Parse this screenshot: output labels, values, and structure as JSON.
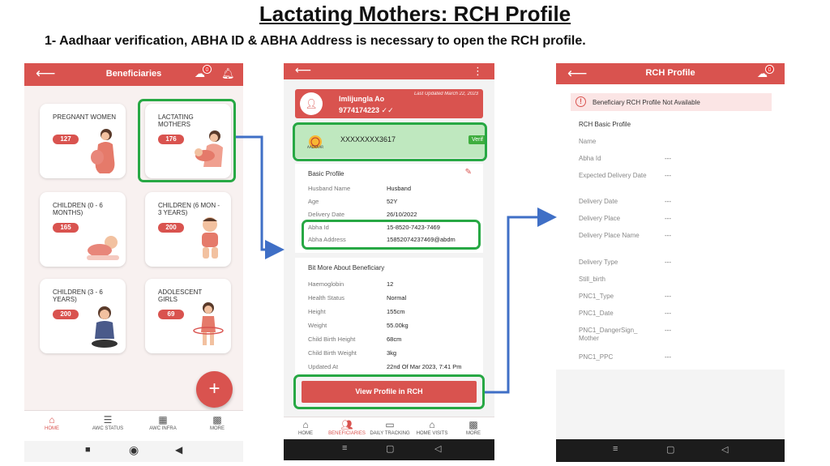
{
  "slide": {
    "title": "Lactating Mothers: RCH Profile",
    "subtitle": "1- Aadhaar verification, ABHA ID & ABHA Address is necessary to open the RCH profile."
  },
  "screen1": {
    "header_title": "Beneficiaries",
    "badge_count": "0",
    "cards": [
      {
        "label": "PREGNANT WOMEN",
        "count": "127"
      },
      {
        "label": "LACTATING MOTHERS",
        "count": "176"
      },
      {
        "label": "CHILDREN (0 - 6 MONTHS)",
        "count": "165"
      },
      {
        "label": "CHILDREN (6 MON - 3 YEARS)",
        "count": "200"
      },
      {
        "label": "CHILDREN (3 - 6 YEARS)",
        "count": "200"
      },
      {
        "label": "ADOLESCENT GIRLS",
        "count": "69"
      }
    ],
    "fab_label": "+",
    "nav": [
      {
        "label": "HOME"
      },
      {
        "label": "AWC STATUS"
      },
      {
        "label": "AWC INFRA"
      },
      {
        "label": "MORE"
      }
    ]
  },
  "screen2": {
    "name": "Imlijungla Ao",
    "phone": "9774174223 ✓✓",
    "last_updated": "Last Updated March 22, 2023",
    "aadhaar_logo_text": "AADHAAR",
    "aadhaar_number": "XXXXXXXX3617",
    "verified_label": "Verif",
    "basic_profile_title": "Basic Profile",
    "basic_rows": [
      {
        "k": "Husband Name",
        "v": "Husband"
      },
      {
        "k": "Age",
        "v": "52Y"
      },
      {
        "k": "Delivery Date",
        "v": "26/10/2022"
      },
      {
        "k": "Abha Id",
        "v": "15-8520-7423-7469"
      },
      {
        "k": "Abha Address",
        "v": "15852074237469@abdm"
      }
    ],
    "more_title": "Bit More About Beneficiary",
    "more_rows": [
      {
        "k": "Haemoglobin",
        "v": "12"
      },
      {
        "k": "Health Status",
        "v": "Normal"
      },
      {
        "k": "Height",
        "v": "155cm"
      },
      {
        "k": "Weight",
        "v": "55.00kg"
      },
      {
        "k": "Child Birth Height",
        "v": "68cm"
      },
      {
        "k": "Child Birth Weight",
        "v": "3kg"
      },
      {
        "k": "Updated At",
        "v": "22nd Of Mar 2023, 7:41 Pm"
      }
    ],
    "rch_button": "View Profile in RCH",
    "nav": [
      {
        "label": "HOME"
      },
      {
        "label": "BENEFICIARIES"
      },
      {
        "label": "DAILY TRACKING"
      },
      {
        "label": "HOME VISITS"
      },
      {
        "label": "MORE"
      }
    ]
  },
  "screen3": {
    "header_title": "RCH Profile",
    "badge_count": "0",
    "notice": "Beneficiary RCH Profile Not Available",
    "section_title": "RCH Basic Profile",
    "rows": [
      {
        "k": "Name",
        "v": ""
      },
      {
        "k": "Abha Id",
        "v": "---"
      },
      {
        "k": "Expected Delivery Date",
        "v": "---"
      },
      {
        "k": "Delivery Date",
        "v": "---"
      },
      {
        "k": "Delivery Place",
        "v": "---"
      },
      {
        "k": "Delivery Place Name",
        "v": "---"
      },
      {
        "k": "Delivery Type",
        "v": "---"
      },
      {
        "k": "Still_birth",
        "v": ""
      },
      {
        "k": "PNC1_Type",
        "v": "---"
      },
      {
        "k": "PNC1_Date",
        "v": "---"
      },
      {
        "k": "PNC1_DangerSign_ Mother",
        "v": "---"
      },
      {
        "k": "PNC1_PPC",
        "v": "---"
      }
    ]
  },
  "colors": {
    "brand_red": "#d9534f",
    "highlight_green": "#27a844",
    "arrow_blue": "#3f6fc6",
    "aadhaar_green": "#bfe8bf"
  }
}
